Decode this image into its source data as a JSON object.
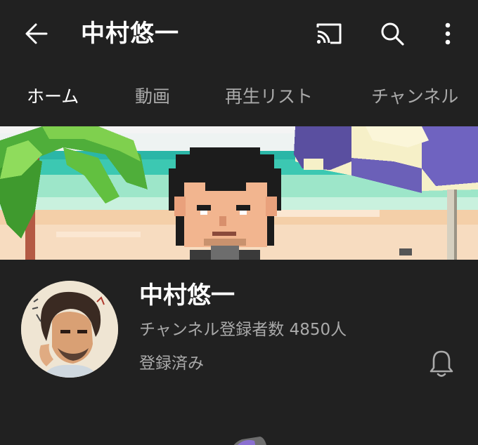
{
  "header": {
    "title": "中村悠一",
    "back_icon": "arrow-back-icon",
    "cast_icon": "cast-icon",
    "search_icon": "search-icon",
    "more_icon": "more-vert-icon"
  },
  "tabs": [
    {
      "label": "ホーム",
      "active": true
    },
    {
      "label": "動画",
      "active": false
    },
    {
      "label": "再生リスト",
      "active": false
    },
    {
      "label": "チャンネル",
      "active": false
    }
  ],
  "channel": {
    "name": "中村悠一",
    "subscribers": "チャンネル登録者数 4850人",
    "subscribe_status": "登録済み",
    "bell_icon": "bell-icon"
  },
  "colors": {
    "background": "#212121",
    "text_primary": "#ffffff",
    "text_secondary": "#aaaaaa"
  }
}
